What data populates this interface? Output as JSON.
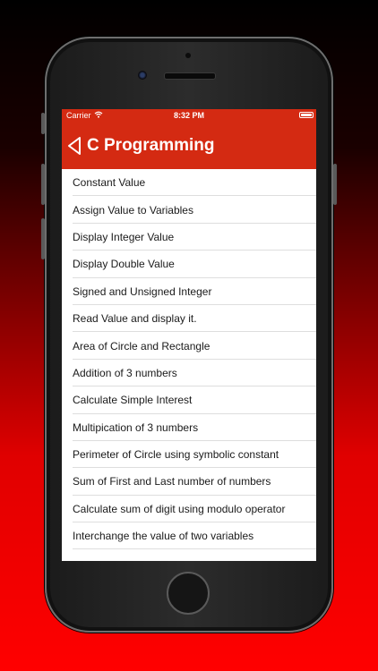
{
  "status_bar": {
    "carrier": "Carrier",
    "time": "8:32 PM"
  },
  "nav": {
    "title": "C Programming",
    "back_icon": "chevron-left-outline-icon",
    "color": "#d42a12"
  },
  "items": [
    {
      "label": "Constant Value"
    },
    {
      "label": "Assign Value to Variables"
    },
    {
      "label": "Display Integer Value"
    },
    {
      "label": "Display Double Value"
    },
    {
      "label": "Signed and Unsigned Integer"
    },
    {
      "label": "Read Value and display it."
    },
    {
      "label": "Area of Circle and Rectangle"
    },
    {
      "label": "Addition of 3 numbers"
    },
    {
      "label": "Calculate Simple Interest"
    },
    {
      "label": "Multipication of 3 numbers"
    },
    {
      "label": "Perimeter of Circle using symbolic constant"
    },
    {
      "label": "Sum of First and Last number of numbers"
    },
    {
      "label": "Calculate sum of digit using modulo operator"
    },
    {
      "label": "Interchange the value of two variables"
    }
  ]
}
